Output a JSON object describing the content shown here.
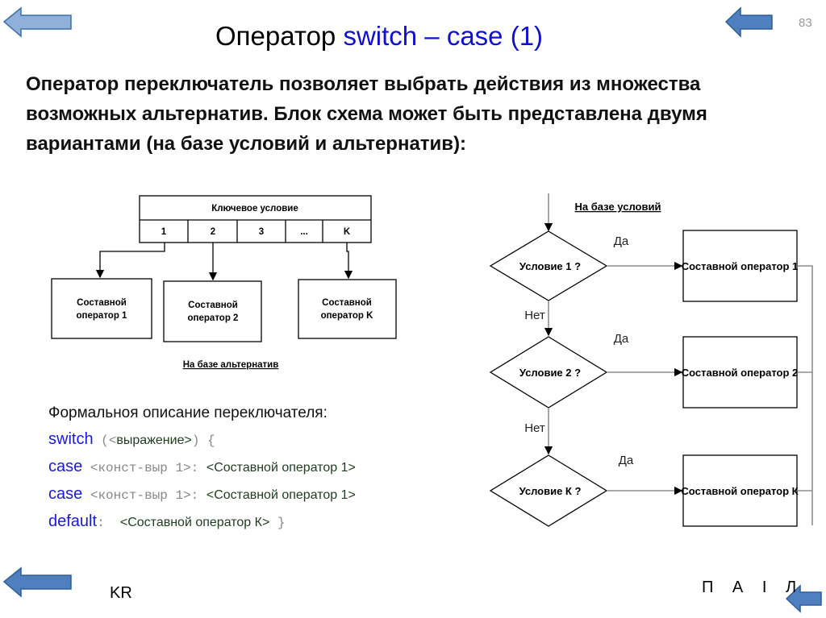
{
  "slide": {
    "page_number": "83",
    "title_prefix": "Оператор ",
    "title_code": "switch – case (1)",
    "intro": "Оператор переключатель позволяет выбрать действия из множества возможных  альтернатив. Блок схема может быть представлена двумя вариантами (на базе условий и альтернатив):",
    "footer_left": "KR",
    "footer_nav": "П А І Л"
  },
  "colors": {
    "arrow_light": "#8fb0d8",
    "arrow_dark": "#4f7fbf",
    "keyword": "#1a1adc"
  },
  "alt_diagram": {
    "header": "Ключевое условие",
    "cells": [
      "1",
      "2",
      "3",
      "...",
      "K"
    ],
    "boxes": [
      [
        "Составной",
        "оператор 1"
      ],
      [
        "Составной",
        "оператор 2"
      ],
      [
        "Составной",
        "оператор K"
      ]
    ],
    "caption": "На базе альтернатив"
  },
  "cond_diagram": {
    "caption": "На базе условий",
    "conditions": [
      "Условие 1 ?",
      "Условие 2 ?",
      "Условие К ?"
    ],
    "boxes": [
      "Составной оператор 1",
      "Составной оператор 2",
      "Составной оператор К"
    ],
    "yes": "Да",
    "no": "Нет"
  },
  "formal": {
    "heading": "Формальноя описание переключателя:",
    "lines": [
      {
        "kw": "switch",
        "a": " (<",
        "b": "выражение>",
        "c": ") {"
      },
      {
        "kw": "case",
        "a": " <конст-выр 1>: ",
        "b": "<Составной оператор 1>",
        "c": ""
      },
      {
        "kw": "case",
        "a": " <конст-выр 1>: ",
        "b": "<Составной оператор 1>",
        "c": ""
      },
      {
        "kw": "default",
        "a": ":  ",
        "b": "<Составной оператор К>",
        "c": " }"
      }
    ]
  }
}
